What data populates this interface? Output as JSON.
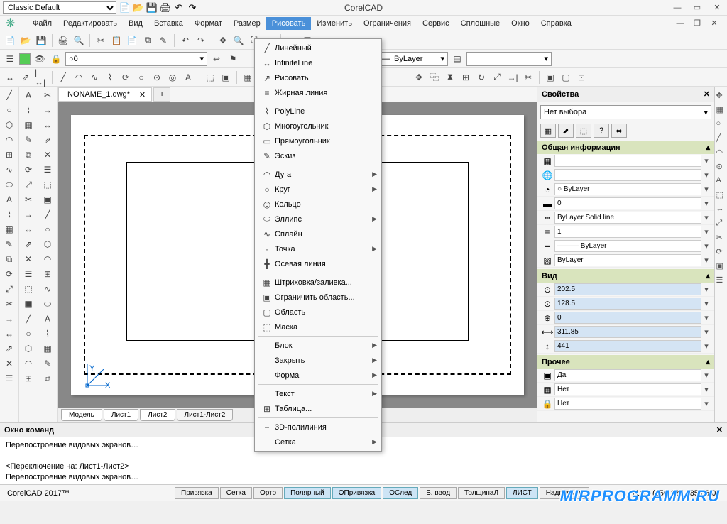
{
  "app": {
    "title": "CorelCAD",
    "workspace": "Classic Default",
    "product": "CorelCAD 2017™"
  },
  "menu": [
    "Файл",
    "Редактировать",
    "Вид",
    "Вставка",
    "Формат",
    "Размер",
    "Рисовать",
    "Изменить",
    "Ограничения",
    "Сервис",
    "Сплошные",
    "Окно",
    "Справка"
  ],
  "active_menu": "Рисовать",
  "dropdown": [
    {
      "label": "Линейный",
      "ico": "╱"
    },
    {
      "label": "InfiniteLine",
      "ico": "↔"
    },
    {
      "label": "Рисовать",
      "ico": "↗"
    },
    {
      "label": "Жирная линия",
      "ico": "≡"
    },
    {
      "sep": true
    },
    {
      "label": "PolyLine",
      "ico": "⌇"
    },
    {
      "label": "Многоугольник",
      "ico": "⬡"
    },
    {
      "label": "Прямоугольник",
      "ico": "▭"
    },
    {
      "label": "Эскиз",
      "ico": "✎"
    },
    {
      "sep": true
    },
    {
      "label": "Дуга",
      "ico": "◠",
      "sub": true
    },
    {
      "label": "Круг",
      "ico": "○",
      "sub": true
    },
    {
      "label": "Кольцо",
      "ico": "◎"
    },
    {
      "label": "Эллипс",
      "ico": "⬭",
      "sub": true
    },
    {
      "label": "Сплайн",
      "ico": "∿"
    },
    {
      "label": "Точка",
      "ico": "·",
      "sub": true
    },
    {
      "label": "Осевая линия",
      "ico": "╋"
    },
    {
      "sep": true
    },
    {
      "label": "Штриховка/заливка...",
      "ico": "▦"
    },
    {
      "label": "Ограничить область...",
      "ico": "▣"
    },
    {
      "label": "Область",
      "ico": "▢"
    },
    {
      "label": "Маска",
      "ico": "⬚"
    },
    {
      "sep": true
    },
    {
      "label": "Блок",
      "ico": "",
      "sub": true
    },
    {
      "label": "Закрыть",
      "ico": "",
      "sub": true
    },
    {
      "label": "Форма",
      "ico": "",
      "sub": true
    },
    {
      "sep": true
    },
    {
      "label": "Текст",
      "ico": "",
      "sub": true
    },
    {
      "label": "Таблица...",
      "ico": "⊞"
    },
    {
      "sep": true
    },
    {
      "label": "3D-полилиния",
      "ico": "⎯"
    },
    {
      "label": "Сетка",
      "ico": "",
      "sub": true
    }
  ],
  "doc": {
    "name": "NONAME_1.dwg*"
  },
  "layer": {
    "current": "0",
    "linetype": "ByLayer"
  },
  "sheets": [
    "Модель",
    "Лист1",
    "Лист2",
    "Лист1-Лист2"
  ],
  "props": {
    "title": "Свойства",
    "selection": "Нет выбора",
    "sections": {
      "general": "Общая информация",
      "view": "Вид",
      "misc": "Прочее"
    },
    "general_rows": [
      {
        "ico": "▦",
        "val": ""
      },
      {
        "ico": "🌐",
        "val": ""
      },
      {
        "ico": "◔",
        "val": "○ ByLayer"
      },
      {
        "ico": "▬",
        "val": "0"
      },
      {
        "ico": "┉",
        "val": "ByLayer    Solid line"
      },
      {
        "ico": "≡",
        "val": "1"
      },
      {
        "ico": "━",
        "val": "——— ByLayer"
      },
      {
        "ico": "▨",
        "val": "ByLayer"
      }
    ],
    "view_rows": [
      {
        "ico": "⊙",
        "val": "202.5"
      },
      {
        "ico": "⊙",
        "val": "128.5"
      },
      {
        "ico": "⊕",
        "val": "0"
      },
      {
        "ico": "⟷",
        "val": "311.85"
      },
      {
        "ico": "↕",
        "val": "441"
      }
    ],
    "misc_rows": [
      {
        "ico": "▣",
        "val": "Да"
      },
      {
        "ico": "▦",
        "val": "Нет"
      },
      {
        "ico": "🔒",
        "val": "Нет"
      }
    ]
  },
  "cmd": {
    "title": "Окно команд",
    "lines": [
      "Перепостроение видовых экранов…",
      "",
      "<Переключение на: Лист1-Лист2>",
      "Перепостроение видовых экранов…"
    ]
  },
  "status": {
    "buttons": [
      {
        "t": "Привязка",
        "b": false
      },
      {
        "t": "Сетка",
        "b": false
      },
      {
        "t": "Орто",
        "b": false
      },
      {
        "t": "Полярный",
        "b": true
      },
      {
        "t": "ОПривязка",
        "b": true
      },
      {
        "t": "ОСлед",
        "b": true
      },
      {
        "t": "Б. ввод",
        "b": false
      },
      {
        "t": "ТолщинаЛ",
        "b": false
      },
      {
        "t": "ЛИСТ",
        "b": true
      }
    ],
    "annot": "Надпись ▼",
    "scale": "(1:1)",
    "coords": "(156.135,285.06,0)"
  },
  "watermark": "MIRPROGRAMM.RU"
}
